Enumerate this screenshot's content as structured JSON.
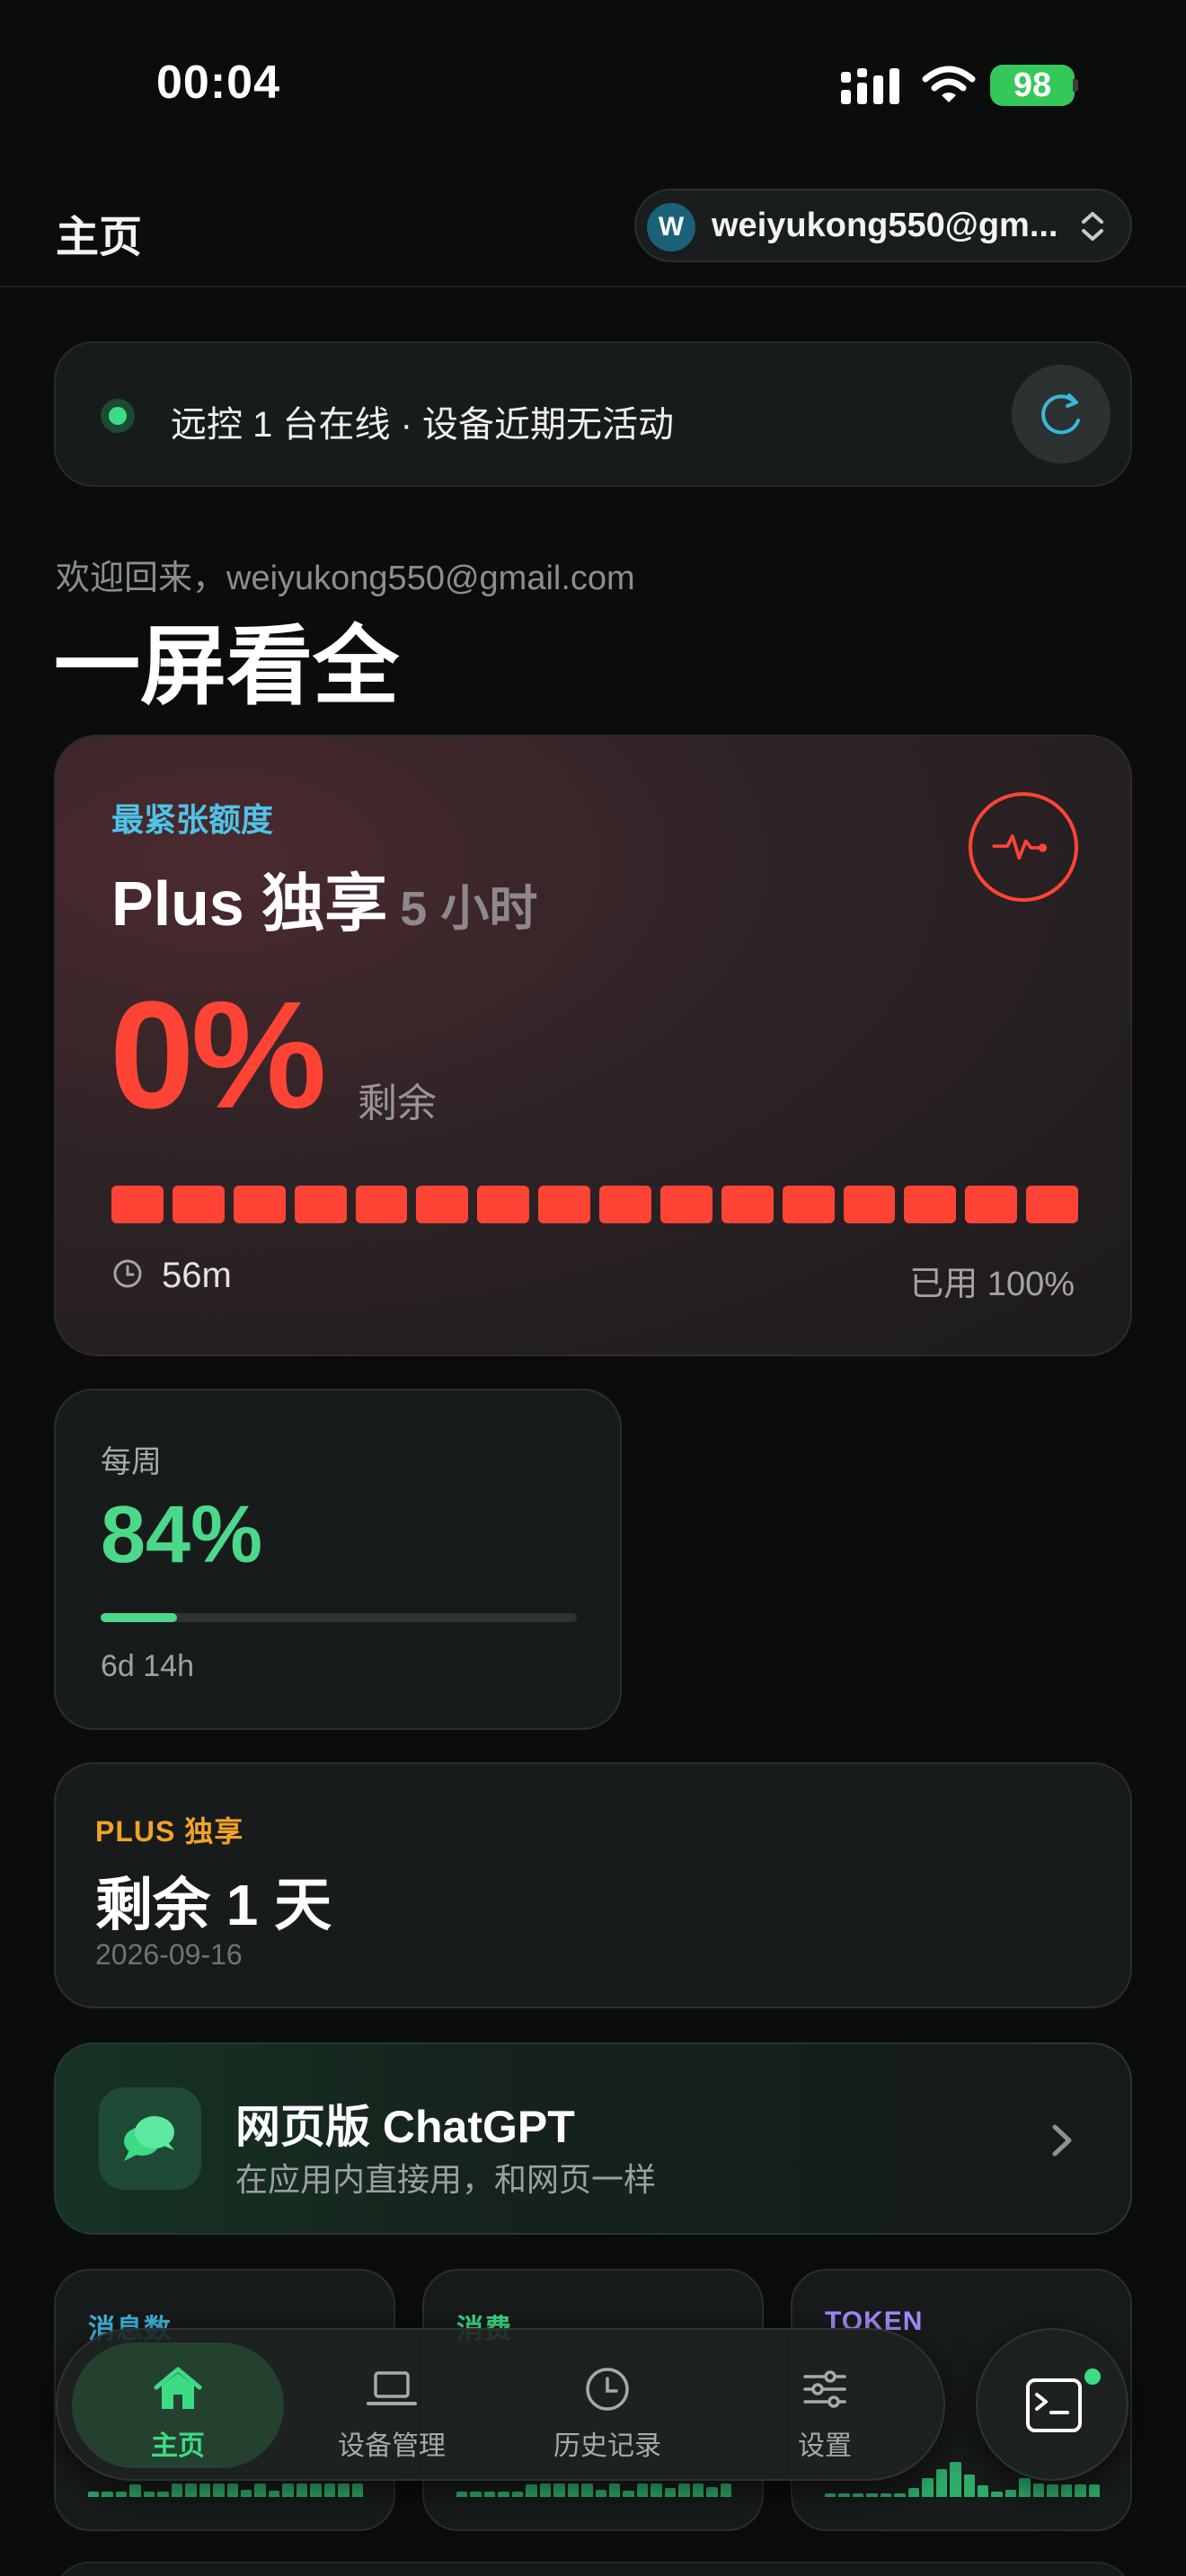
{
  "status_bar": {
    "time": "00:04",
    "battery": "98"
  },
  "header": {
    "title": "主页",
    "account_initial": "W",
    "account_email": "weiyukong550@gm..."
  },
  "remote": {
    "status_text": "远控 1 台在线 · 设备近期无活动"
  },
  "welcome": {
    "greeting": "欢迎回来，weiyukong550@gmail.com",
    "headline": "一屏看全"
  },
  "quota": {
    "label": "最紧张额度",
    "plan": "Plus 独享",
    "window": "5 小时",
    "percent": "0%",
    "remaining_label": "剩余",
    "segments": 16,
    "used_fraction": 1.0,
    "reset_time": "56m",
    "used_text": "已用 100%",
    "accent_color": "#ff4436"
  },
  "weekly": {
    "label": "每周",
    "percent": "84%",
    "progress_fraction": 0.16,
    "reset_time": "6d 14h",
    "accent_color": "#4cd88a"
  },
  "plan_card": {
    "label": "PLUS 独享",
    "remaining": "剩余 1 天",
    "expiry": "2026-09-16"
  },
  "web_chatgpt": {
    "title": "网页版 ChatGPT",
    "subtitle": "在应用内直接用，和网页一样"
  },
  "stats": [
    {
      "label": "消息数",
      "color": "#3fb7e0"
    },
    {
      "label": "消费",
      "color": "#3ddc84"
    },
    {
      "label": "TOKEN",
      "color": "#a78bfa"
    }
  ],
  "nav": {
    "tabs": [
      {
        "label": "主页",
        "icon": "home-icon",
        "active": true
      },
      {
        "label": "设备管理",
        "icon": "laptop-icon",
        "active": false
      },
      {
        "label": "历史记录",
        "icon": "clock-icon",
        "active": false
      },
      {
        "label": "设置",
        "icon": "sliders-icon",
        "active": false
      }
    ],
    "fab_icon": "terminal-icon"
  }
}
